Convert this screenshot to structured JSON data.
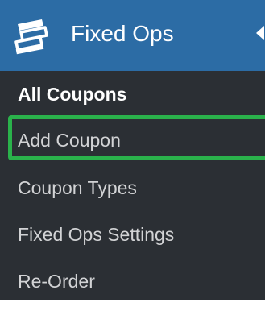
{
  "menu": {
    "title": "Fixed Ops",
    "icon": "coupons-stack-icon",
    "accent_color": "#2c6ca5",
    "submenu_bg": "#2b2f34",
    "highlight_color": "#2ab24b",
    "items": [
      {
        "label": "All Coupons",
        "current": true
      },
      {
        "label": "Add Coupon",
        "highlighted": true
      },
      {
        "label": "Coupon Types"
      },
      {
        "label": "Fixed Ops Settings"
      },
      {
        "label": "Re-Order"
      }
    ]
  }
}
